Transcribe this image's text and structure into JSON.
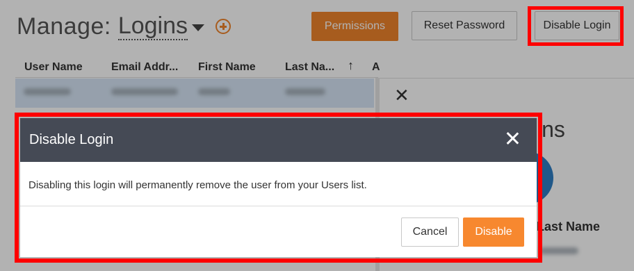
{
  "header": {
    "title_prefix": "Manage:",
    "module": "Logins",
    "permissions_label": "Permissions",
    "reset_password_label": "Reset Password",
    "disable_login_label": "Disable Login"
  },
  "grid": {
    "columns": [
      "User Name",
      "Email Addr...",
      "First Name",
      "Last Na...",
      "A"
    ]
  },
  "side_panel": {
    "title_fragment": "ins",
    "last_name_label": "Last Name"
  },
  "modal": {
    "title": "Disable Login",
    "message": "Disabling this login will permanently remove the user from your Users list.",
    "cancel_label": "Cancel",
    "confirm_label": "Disable"
  },
  "colors": {
    "accent": "#f0842c",
    "modal_header": "#454a55",
    "highlight": "#ff0000"
  }
}
